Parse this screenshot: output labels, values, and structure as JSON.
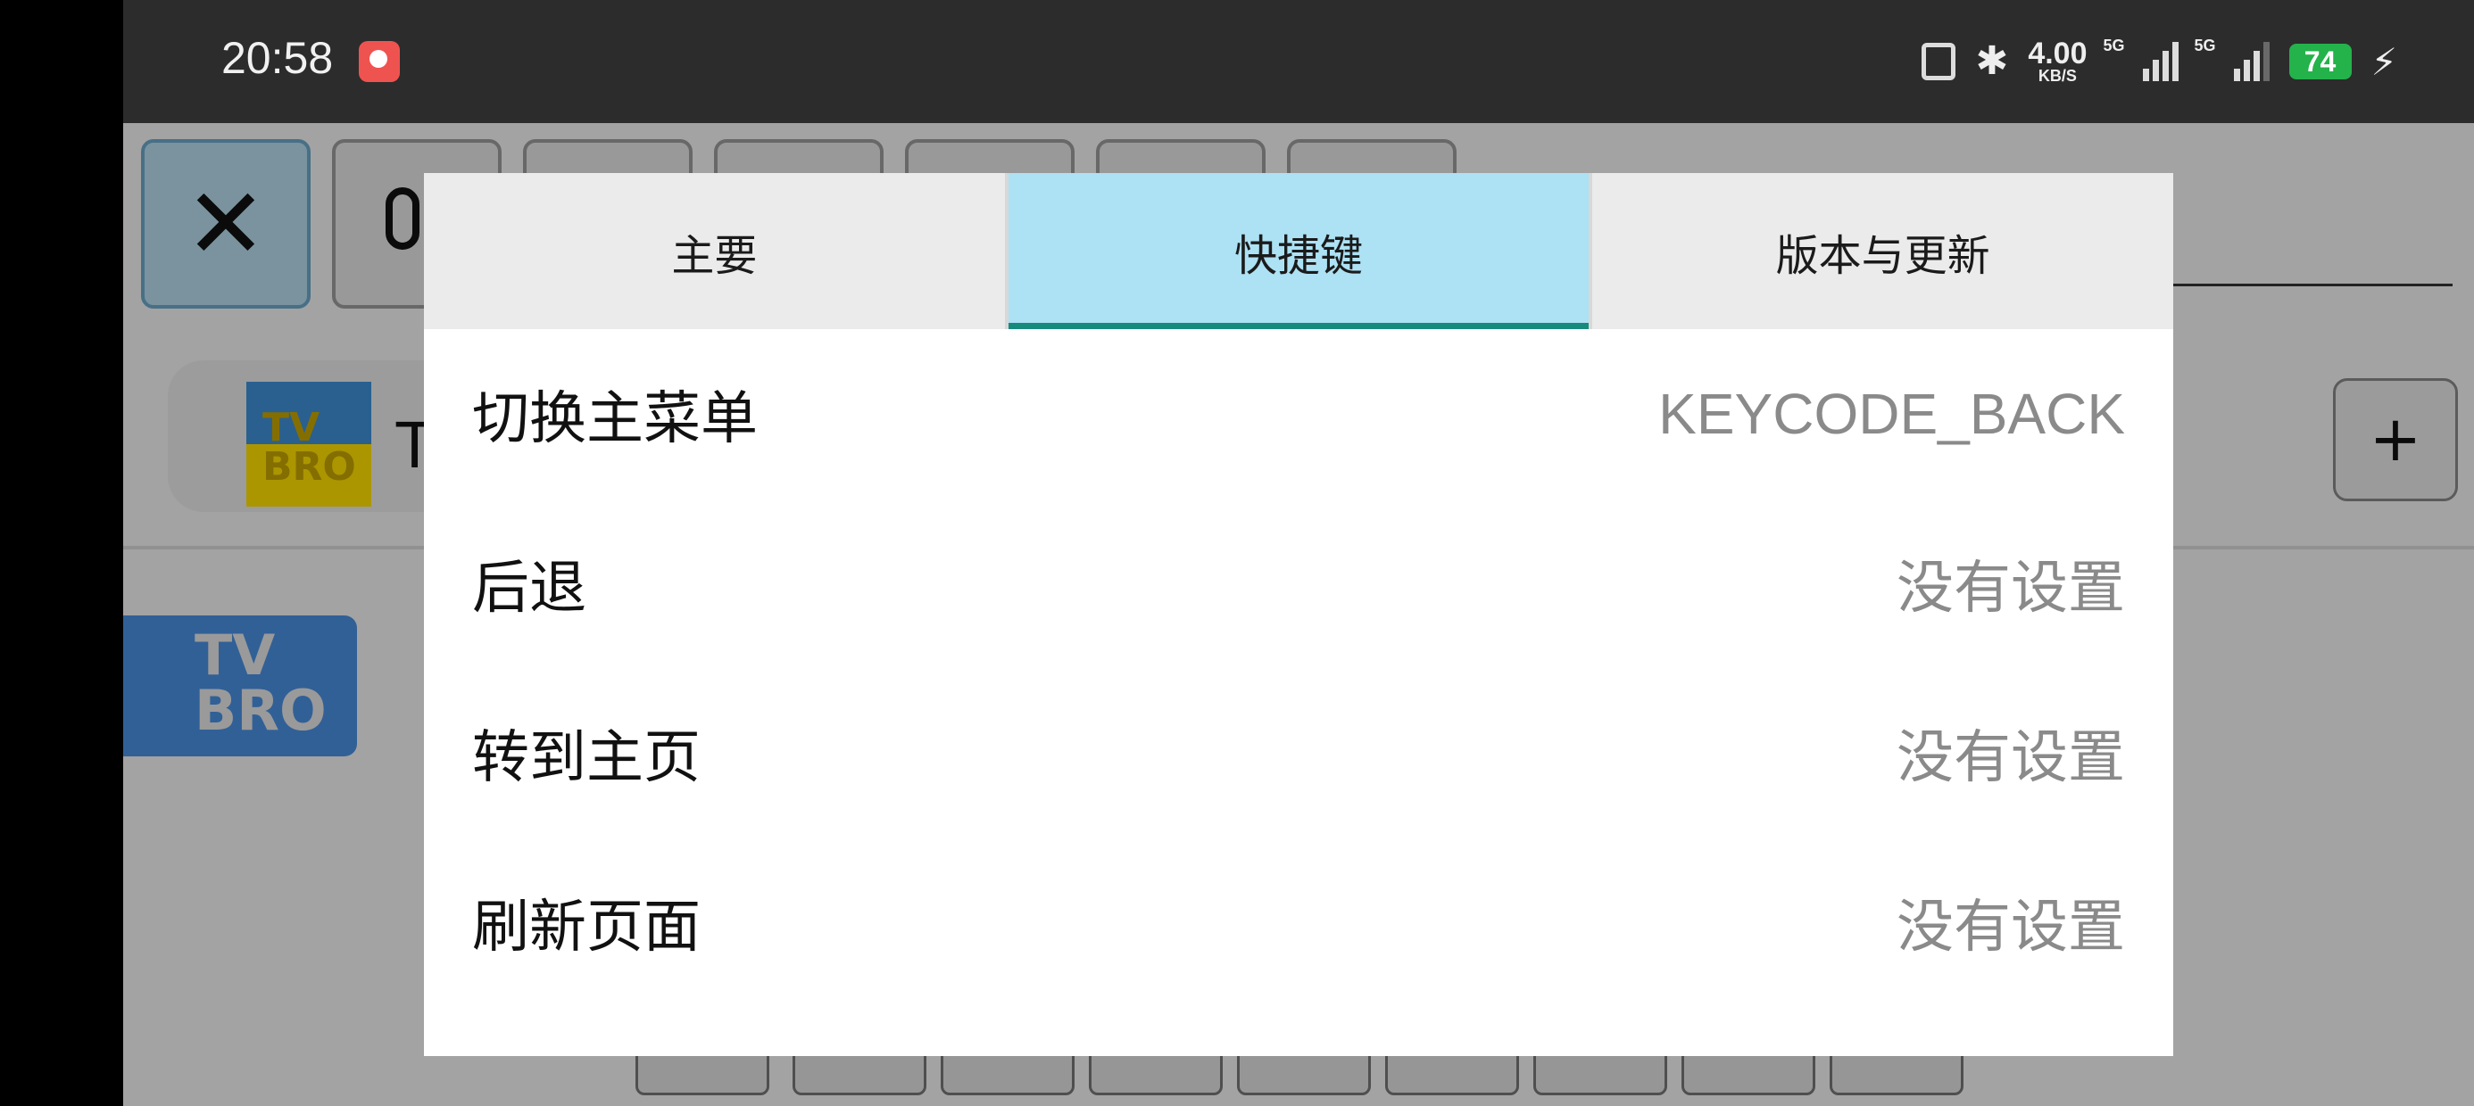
{
  "status_bar": {
    "time": "20:58",
    "net_speed": "4.00",
    "net_speed_unit": "KB/S",
    "signal1_label": "5G",
    "signal2_label": "5G",
    "battery": "74",
    "icons": [
      "app-notification-icon",
      "nfc-icon",
      "bluetooth-icon",
      "signal-icon",
      "battery-icon",
      "charging-icon"
    ]
  },
  "background": {
    "toolbar_icons": [
      "close-icon",
      "microphone-icon"
    ],
    "tab_title": "TV",
    "tab_logo_text": "TV BRO",
    "add_tab_label": "+",
    "home_logo_text": "TV BRO"
  },
  "dialog": {
    "tabs": [
      {
        "label": "主要",
        "active": false
      },
      {
        "label": "快捷键",
        "active": true
      },
      {
        "label": "版本与更新",
        "active": false
      }
    ],
    "shortcuts": [
      {
        "label": "切换主菜单",
        "value": "KEYCODE_BACK"
      },
      {
        "label": "后退",
        "value": "没有设置"
      },
      {
        "label": "转到主页",
        "value": "没有设置"
      },
      {
        "label": "刷新页面",
        "value": "没有设置"
      }
    ]
  },
  "colors": {
    "active_tab_bg": "#ade1f4",
    "active_tab_indicator": "#168a7d",
    "tab_bg": "#ebebeb",
    "battery": "#24b24b"
  }
}
